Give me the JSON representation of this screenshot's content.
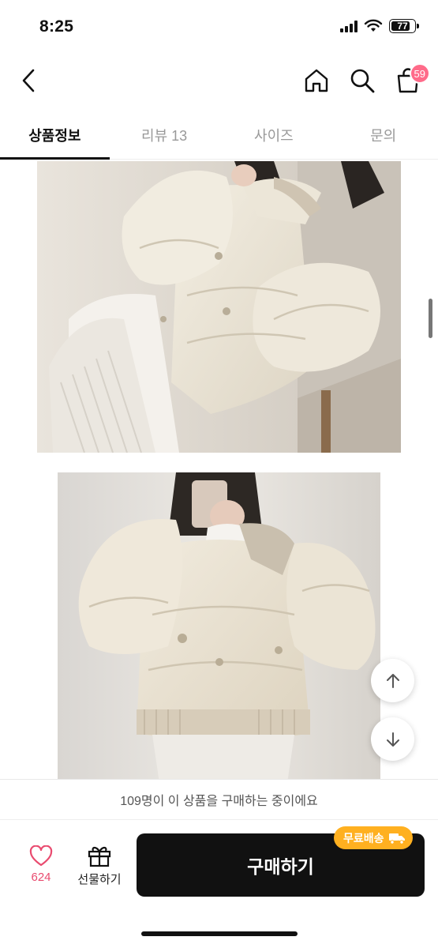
{
  "status_bar": {
    "time": "8:25",
    "battery": "77"
  },
  "nav": {
    "cart_badge": "59"
  },
  "tabs": [
    {
      "label": "상품정보",
      "active": true
    },
    {
      "label": "리뷰 13",
      "active": false
    },
    {
      "label": "사이즈",
      "active": false
    },
    {
      "label": "문의",
      "active": false
    }
  ],
  "notice": {
    "text": "109명이 이 상품을 구매하는 중이에요"
  },
  "bottom_bar": {
    "like_count": "624",
    "gift_label": "선물하기",
    "buy_label": "구매하기",
    "shipping_badge": "무료배송"
  },
  "colors": {
    "accent_pink": "#e94b6f",
    "badge_pink": "#ff6b8a",
    "shipping_orange": "#ffb020",
    "buy_button": "#111111"
  },
  "icons": [
    "back-icon",
    "home-icon",
    "search-icon",
    "cart-icon",
    "heart-icon",
    "gift-icon",
    "arrow-up-icon",
    "arrow-down-icon",
    "truck-icon"
  ]
}
